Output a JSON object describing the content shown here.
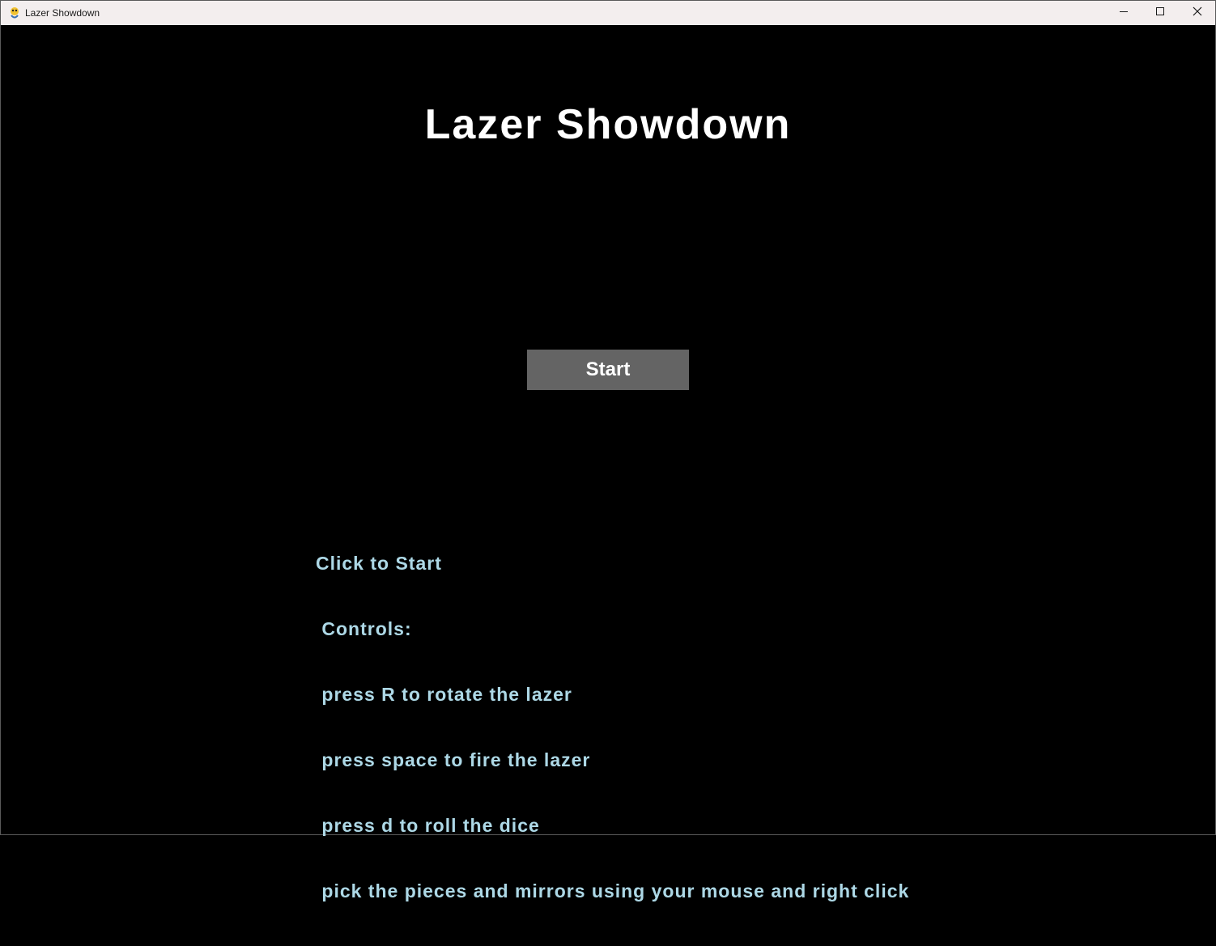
{
  "window": {
    "title": "Lazer Showdown",
    "app_icon": "python-snake-icon",
    "controls": {
      "minimize_icon": "minimize-icon",
      "maximize_icon": "maximize-icon",
      "close_icon": "close-icon"
    }
  },
  "game": {
    "title": "Lazer Showdown",
    "start_button_label": "Start",
    "instructions": [
      "Click to Start",
      " Controls:",
      " press R to rotate the lazer",
      " press space to fire the lazer",
      " press d to roll the dice",
      " pick the pieces and mirrors using your mouse and right click"
    ]
  },
  "colors": {
    "background": "#000000",
    "title_text": "#ffffff",
    "button_bg": "#646464",
    "instruction_text": "#add8e6",
    "titlebar_bg": "#f3eeee"
  }
}
